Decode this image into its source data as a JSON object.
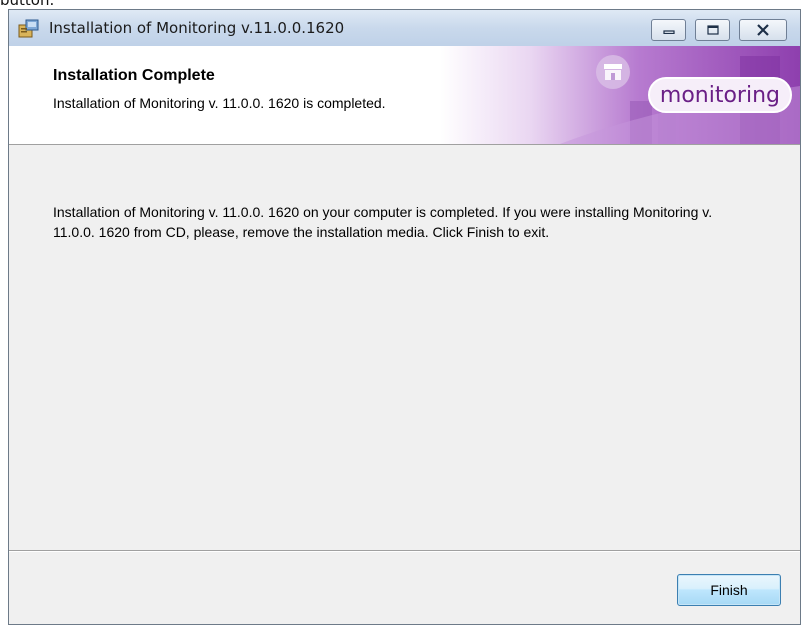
{
  "cropped_top_text": "button.",
  "window": {
    "title": "Installation of Monitoring v.11.0.0.1620",
    "controls": {
      "minimize": "minimize",
      "maximize": "maximize",
      "close": "close"
    }
  },
  "header": {
    "title": "Installation Complete",
    "subtitle": "Installation of Monitoring v. 11.0.0. 1620 is completed.",
    "logo_text": "monitoring"
  },
  "body": {
    "message": "Installation of Monitoring v. 11.0.0. 1620 on your computer is completed. If you were installing Monitoring v. 11.0.0. 1620 from CD, please, remove the installation media. Click Finish to exit."
  },
  "footer": {
    "finish_label": "Finish"
  },
  "colors": {
    "accent": "#6a1f86",
    "dialog_bg": "#f0f0f0",
    "button_border": "#3c7fb1"
  },
  "icons": [
    "installer-icon",
    "minimize-icon",
    "maximize-icon",
    "close-icon",
    "store-icon"
  ]
}
